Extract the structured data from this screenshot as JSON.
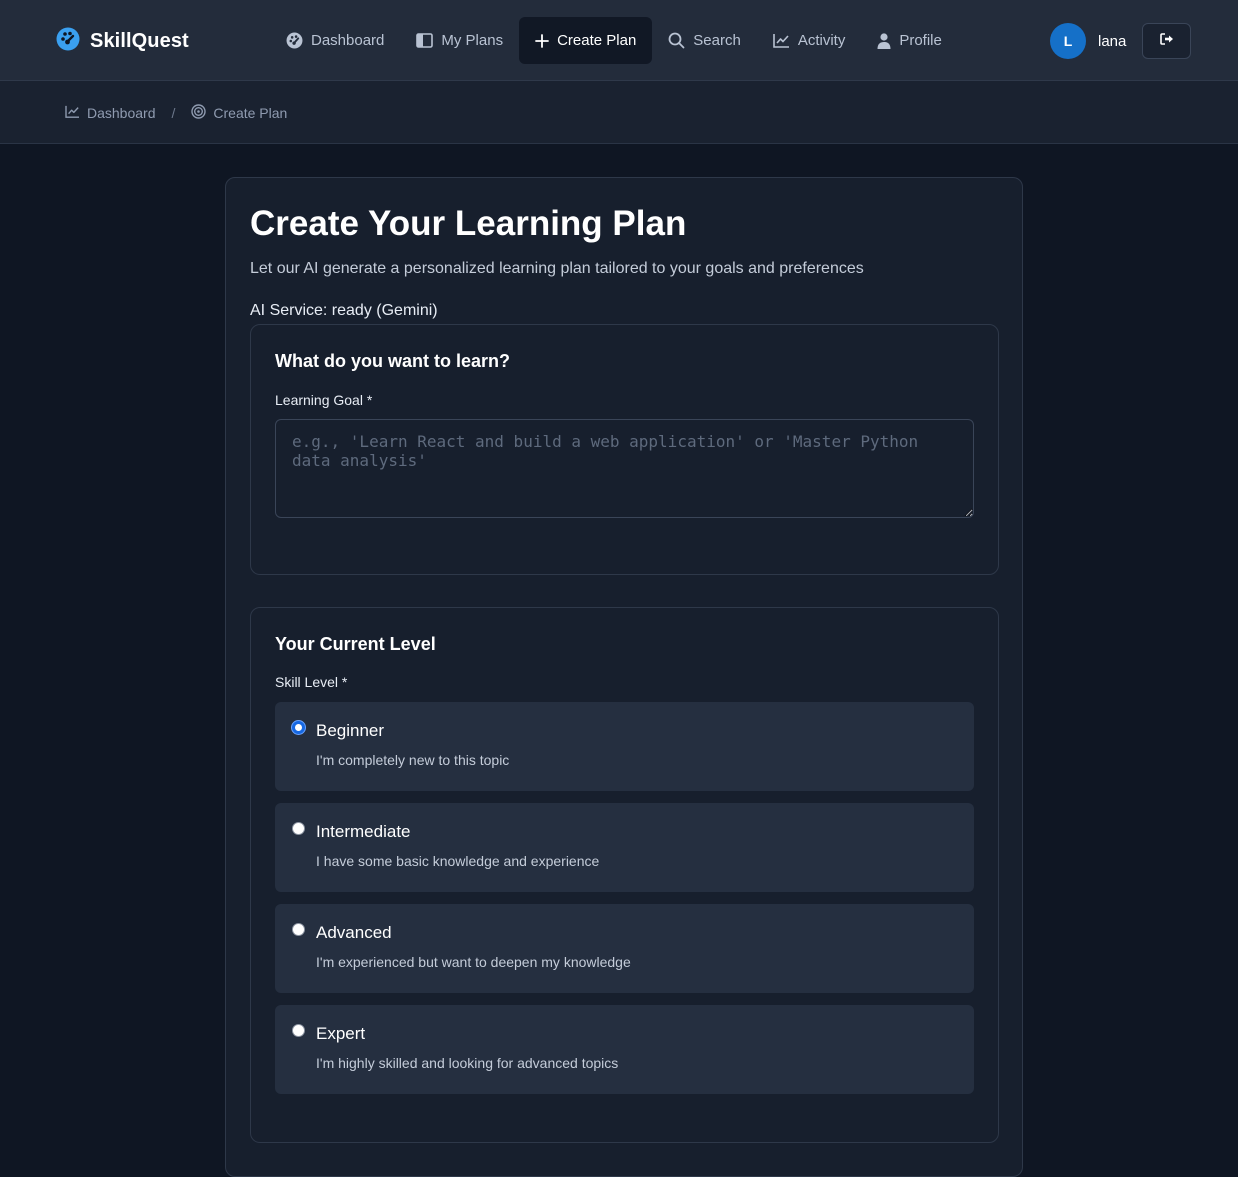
{
  "app": {
    "name": "SkillQuest"
  },
  "nav": {
    "items": [
      {
        "label": "Dashboard",
        "icon": "gauge-icon"
      },
      {
        "label": "My Plans",
        "icon": "book-icon"
      },
      {
        "label": "Create Plan",
        "icon": "plus-icon",
        "active": true
      },
      {
        "label": "Search",
        "icon": "search-icon"
      },
      {
        "label": "Activity",
        "icon": "chart-line-icon"
      },
      {
        "label": "Profile",
        "icon": "user-icon"
      }
    ]
  },
  "user": {
    "initial": "L",
    "name": "lana"
  },
  "breadcrumb": {
    "items": [
      {
        "label": "Dashboard",
        "icon": "chart-line-icon"
      },
      {
        "label": "Create Plan",
        "icon": "target-icon"
      }
    ],
    "separator": "/"
  },
  "page": {
    "title": "Create Your Learning Plan",
    "subtitle": "Let our AI generate a personalized learning plan tailored to your goals and preferences",
    "ai_status": "AI Service: ready (Gemini)"
  },
  "goal_section": {
    "title": "What do you want to learn?",
    "label": "Learning Goal *",
    "value": "",
    "placeholder": "e.g., 'Learn React and build a web application' or 'Master Python data analysis'"
  },
  "level_section": {
    "title": "Your Current Level",
    "label": "Skill Level *",
    "options": [
      {
        "name": "Beginner",
        "desc": "I'm completely new to this topic",
        "selected": true
      },
      {
        "name": "Intermediate",
        "desc": "I have some basic knowledge and experience",
        "selected": false
      },
      {
        "name": "Advanced",
        "desc": "I'm experienced but want to deepen my knowledge",
        "selected": false
      },
      {
        "name": "Expert",
        "desc": "I'm highly skilled and looking for advanced topics",
        "selected": false
      }
    ]
  },
  "colors": {
    "accent": "#1668e3",
    "brand_icon": "#3aa0f0",
    "avatar": "#1570c8"
  }
}
